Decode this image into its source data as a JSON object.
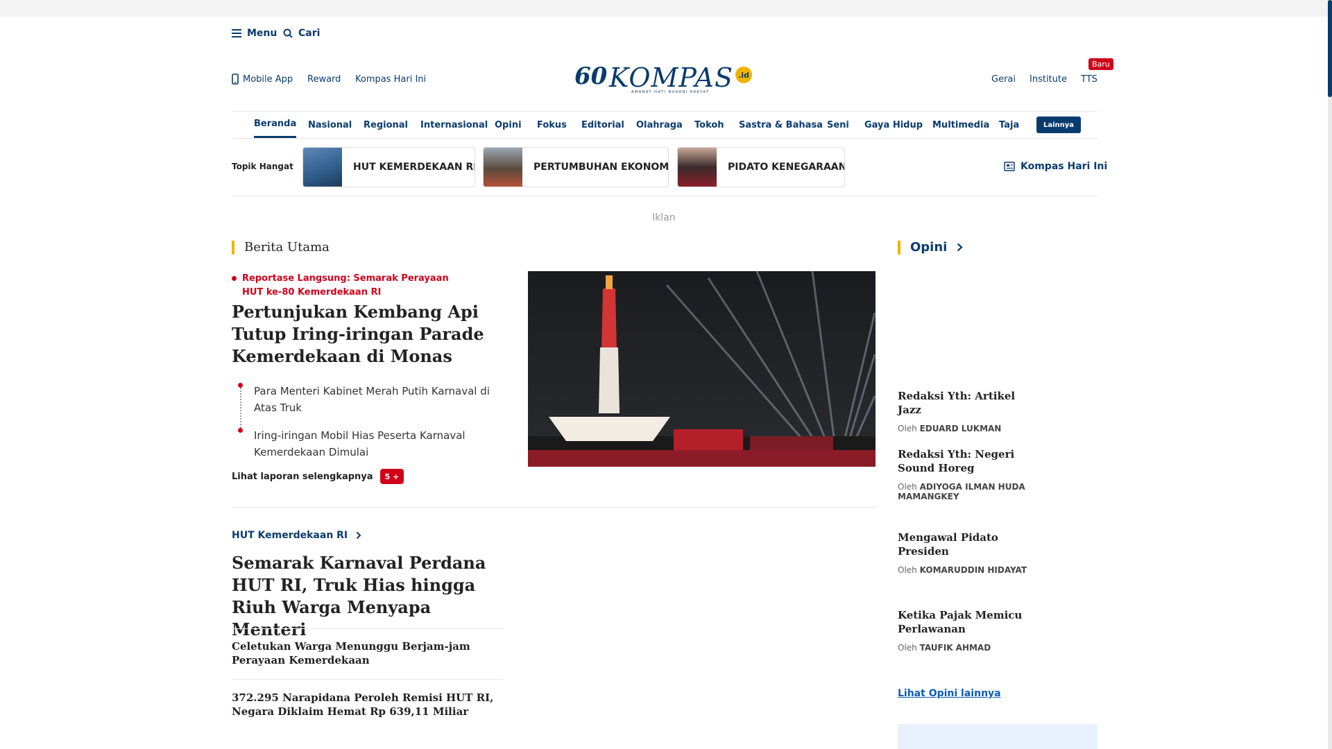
{
  "topbar": {
    "menu_label": "Menu",
    "search_label": "Cari"
  },
  "header": {
    "left_links": [
      "Mobile App",
      "Reward",
      "Kompas Hari Ini"
    ],
    "logo_anniv": "60",
    "logo_text": "KOMPAS",
    "logo_suffix": ".id",
    "logo_tagline": "AMANAT HATI NURANI RAKYAT",
    "right_links": [
      "Gerai",
      "Institute",
      "TTS"
    ],
    "tts_badge": "Baru"
  },
  "nav": {
    "items": [
      "Beranda",
      "Nasional",
      "Regional",
      "Internasional",
      "Opini",
      "Fokus",
      "Editorial",
      "Olahraga",
      "Tokoh",
      "Sastra & Bahasa",
      "Seni",
      "Gaya Hidup",
      "Multimedia",
      "Taja"
    ],
    "more_label": "Lainnya",
    "active": "Beranda"
  },
  "topik": {
    "label": "Topik Hangat",
    "items": [
      "HUT KEMERDEKAAN RI",
      "PERTUMBUHAN EKONOMI",
      "PIDATO KENEGARAAN"
    ],
    "right_link": "Kompas Hari Ini"
  },
  "ad_label": "Iklan",
  "berita_utama": {
    "heading": "Berita Utama",
    "live_tag": "Reportase Langsung: Semarak Perayaan HUT ke-80 Kemerdekaan RI",
    "headline": "Pertunjukan Kembang Api Tutup Iring-iringan Parade Kemerdekaan di Monas",
    "sub_items": [
      "Para Menteri Kabinet Merah Putih Karnaval di Atas Truk",
      "Iring-iringan Mobil Hias Peserta Karnaval Kemerdekaan Dimulai"
    ],
    "more_label": "Lihat laporan selengkapnya",
    "more_badge": "5 +"
  },
  "hut_section": {
    "tag": "HUT Kemerdekaan RI",
    "headline": "Semarak Karnaval Perdana HUT RI, Truk Hias hingga Riuh Warga Menyapa Menteri",
    "related": [
      "Celetukan Warga Menunggu Berjam-jam Perayaan Kemerdekaan",
      "372.295 Narapidana Peroleh Remisi HUT RI, Negara Diklaim Hemat Rp 639,11 Miliar"
    ]
  },
  "opini": {
    "heading": "Opini",
    "by_prefix": "Oleh",
    "items": [
      {
        "title": "Redaksi Yth: Artikel Jazz",
        "author": "EDUARD LUKMAN"
      },
      {
        "title": "Redaksi Yth: Negeri Sound Horeg",
        "author": "ADIYOGA ILMAN HUDA MAMANGKEY"
      },
      {
        "title": "Mengawal Pidato Presiden",
        "author": "KOMARUDDIN HIDAYAT"
      },
      {
        "title": "Ketika Pajak Memicu Perlawanan",
        "author": "TAUFIK AHMAD"
      }
    ],
    "more_label": "Lihat Opini lainnya"
  },
  "colors": {
    "brand": "#0a3b6e",
    "accent_red": "#d0021b",
    "accent_yellow": "#f0b400"
  }
}
